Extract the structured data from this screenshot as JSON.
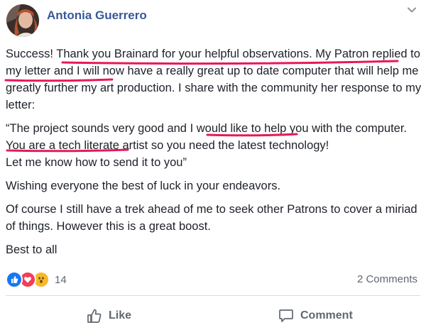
{
  "post": {
    "author": "Antonia Guerrero",
    "paragraphs": {
      "p1": {
        "a": "Success! ",
        "b": "Thank you Brainard for your helpful observations. My Patron replied to my letter",
        "c": " and I will now have a really great up to date computer that will help me greatly further my art production. I share with the community her response to my letter:"
      },
      "p2": {
        "a": "“The project sounds very good and ",
        "b": "I would like to help you with the computer",
        "c": ". You are a tech literate artist so you need the latest technology!",
        "d": "Let me know how to send it to you”"
      },
      "p3": "Wishing everyone the best of luck in your endeavors.",
      "p4": "Of course I still have a trek ahead of me to seek other Patrons to cover a miriad of things. However this is a great boost.",
      "p5": "Best to all"
    }
  },
  "reactions": {
    "icons": [
      "like-icon",
      "love-icon",
      "wow-icon"
    ],
    "count": "14",
    "comments_label": "2 Comments"
  },
  "actions": {
    "like_label": "Like",
    "comment_label": "Comment"
  },
  "colors": {
    "author": "#385898",
    "underline": "#e8185a",
    "like": "#1877f2",
    "love": "#f33e58",
    "wow": "#f7b928"
  }
}
